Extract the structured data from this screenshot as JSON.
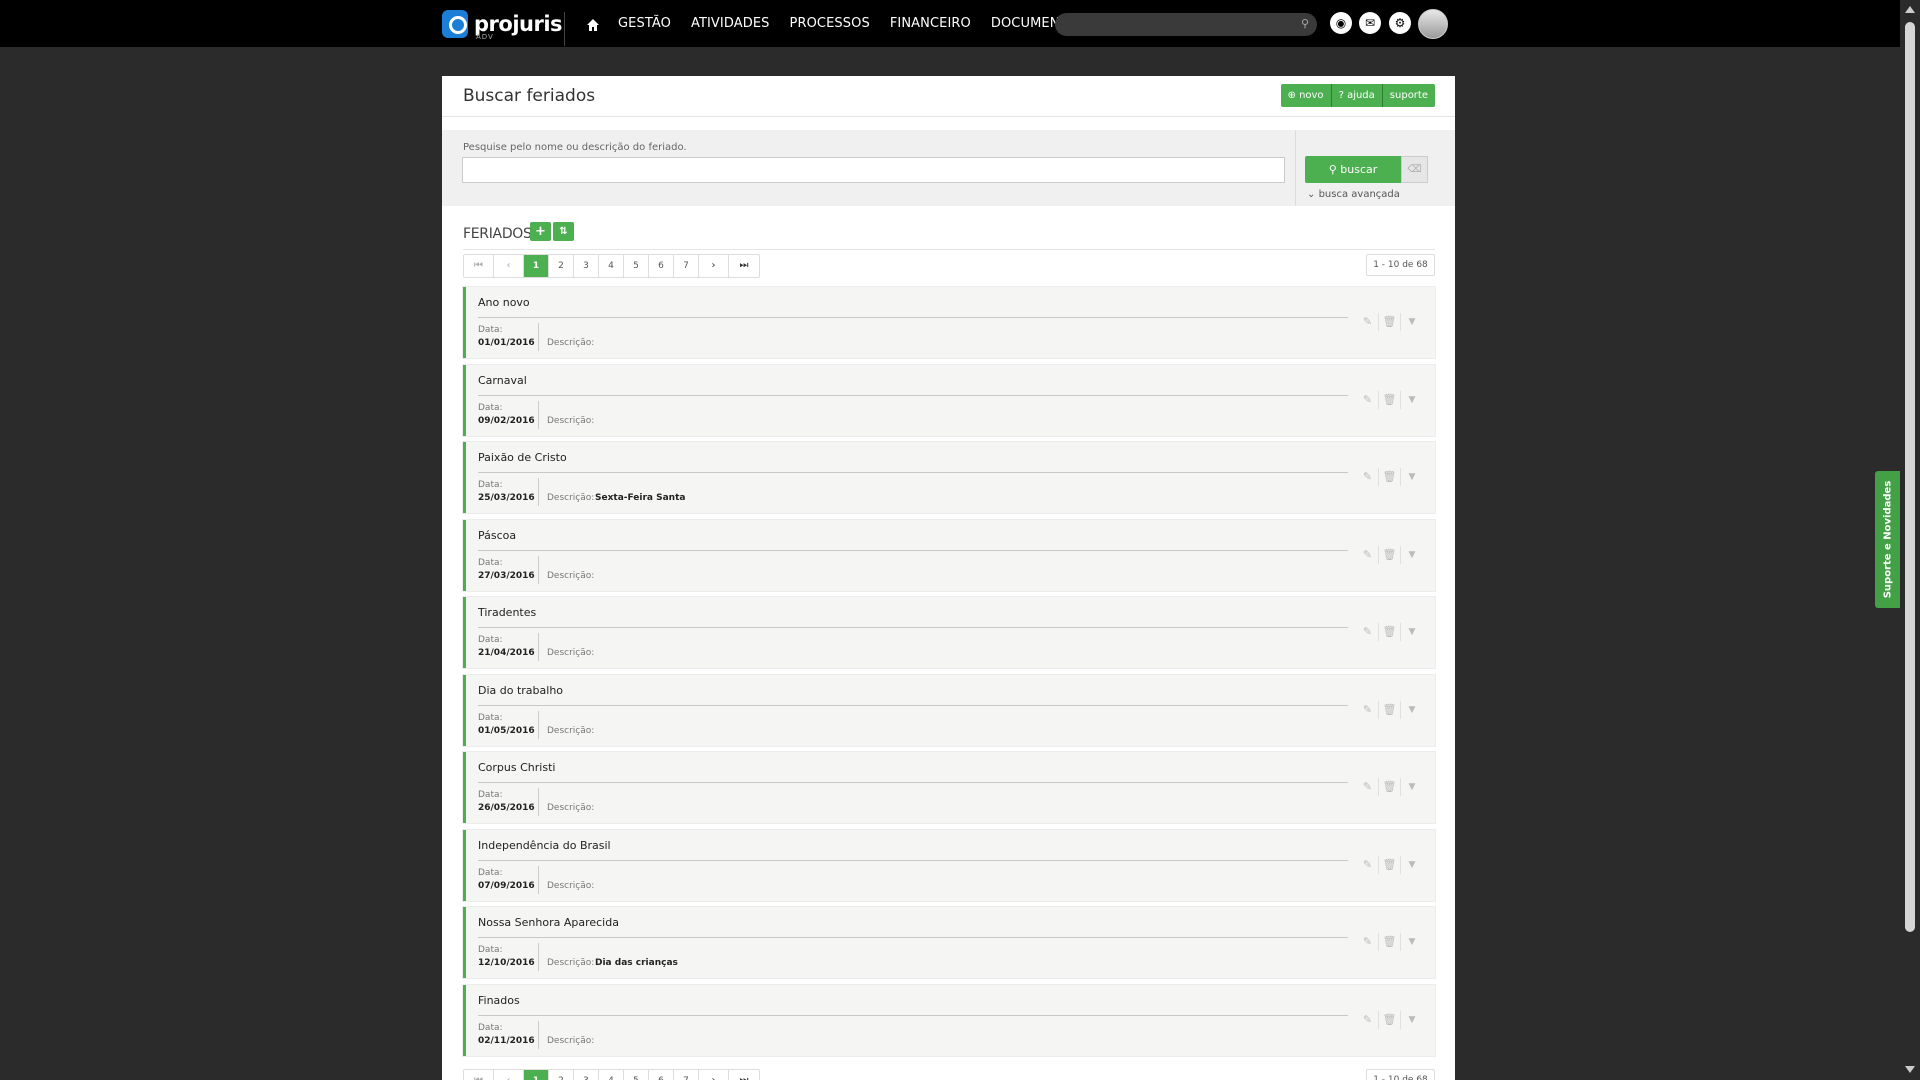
{
  "brand": {
    "name": "projuris",
    "sub": "ADV"
  },
  "nav": {
    "items": [
      "GESTÃO",
      "ATIVIDADES",
      "PROCESSOS",
      "FINANCEIRO",
      "DOCUMENTOS"
    ]
  },
  "page": {
    "title": "Buscar feriados",
    "buttons": {
      "novo": "novo",
      "ajuda": "ajuda",
      "suporte": "suporte"
    }
  },
  "search": {
    "label": "Pesquise pelo nome ou descrição do feriado.",
    "value": "",
    "button": "buscar",
    "advanced": "busca avançada"
  },
  "section": {
    "title": "FERIADOS"
  },
  "pager": {
    "pages": [
      "1",
      "2",
      "3",
      "4",
      "5",
      "6",
      "7"
    ],
    "active": "1",
    "count": "1 - 10 de 68"
  },
  "labels": {
    "date": "Data:",
    "description": "Descrição:"
  },
  "records": [
    {
      "name": "Ano novo",
      "date": "01/01/2016",
      "description": ""
    },
    {
      "name": "Carnaval",
      "date": "09/02/2016",
      "description": ""
    },
    {
      "name": "Paixão de Cristo",
      "date": "25/03/2016",
      "description": "Sexta-Feira Santa"
    },
    {
      "name": "Páscoa",
      "date": "27/03/2016",
      "description": ""
    },
    {
      "name": "Tiradentes",
      "date": "21/04/2016",
      "description": ""
    },
    {
      "name": "Dia do trabalho",
      "date": "01/05/2016",
      "description": ""
    },
    {
      "name": "Corpus Christi",
      "date": "26/05/2016",
      "description": ""
    },
    {
      "name": "Independência do Brasil",
      "date": "07/09/2016",
      "description": ""
    },
    {
      "name": "Nossa Senhora Aparecida",
      "date": "12/10/2016",
      "description": "Dia das crianças"
    },
    {
      "name": "Finados",
      "date": "02/11/2016",
      "description": ""
    }
  ],
  "side_tab": {
    "label": "Suporte e Novidades"
  },
  "icons": {
    "home": "home-icon",
    "search": "search-icon",
    "help": "help-circle-icon",
    "mail": "mail-icon",
    "settings": "gear-icon",
    "edit": "edit-icon",
    "delete": "trash-icon",
    "expand": "caret-down-icon"
  },
  "colors": {
    "accent": "#4caf50",
    "topbar": "#000000",
    "background": "#2b2b2b"
  }
}
